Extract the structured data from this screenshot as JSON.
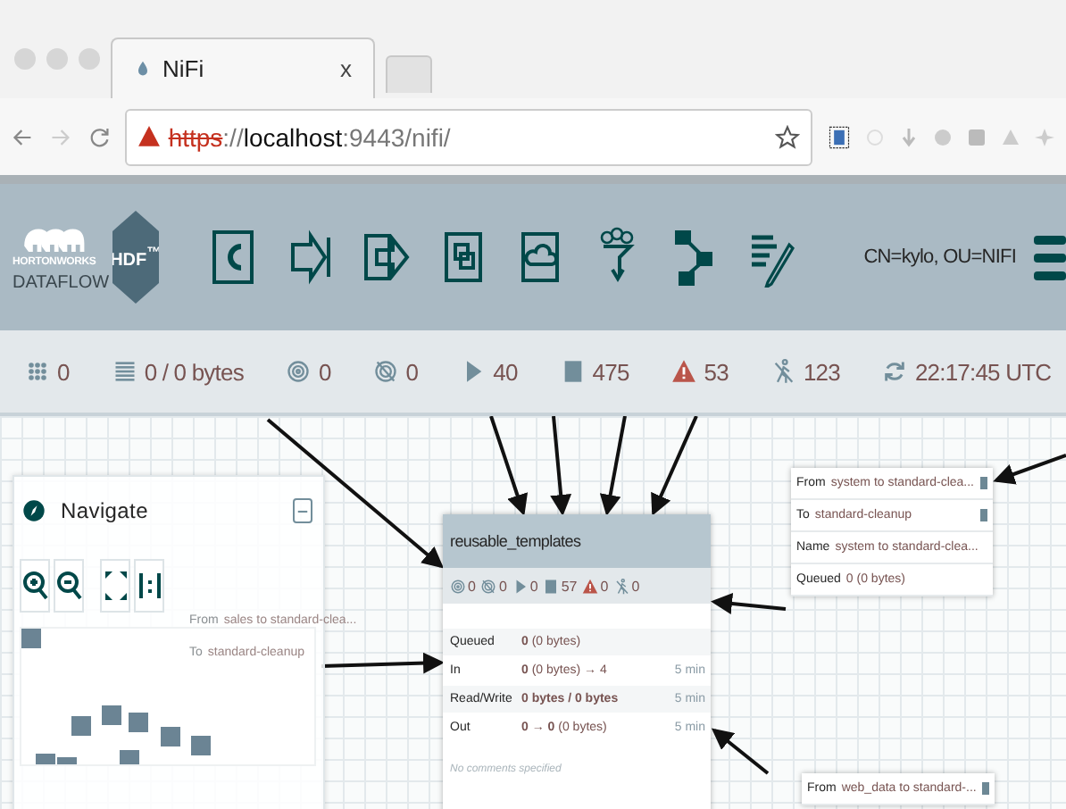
{
  "browser": {
    "tabs": [
      {
        "title": "NiFi",
        "close": "x",
        "selected": true
      }
    ],
    "address": [
      {
        "kind": "scheme",
        "text": "https"
      },
      {
        "kind": "plain",
        "text": "://"
      },
      {
        "kind": "host",
        "text": "localhost"
      },
      {
        "kind": "plain",
        "text": ":9443/nifi/"
      }
    ]
  },
  "header": {
    "logo": {
      "brand": "HORTONWORKS",
      "product": "DATAFLOW",
      "badge": "HDF$^{™}$"
    },
    "toolbar": [
      {
        "kind": "processor"
      },
      {
        "kind": "input-port"
      },
      {
        "kind": "output-port"
      },
      {
        "kind": "process-group"
      },
      {
        "kind": "remote-group"
      },
      {
        "kind": "funnel"
      },
      {
        "kind": "template"
      },
      {
        "kind": "label"
      }
    ],
    "user": "CN=kylo, OU=NIFI"
  },
  "status_bar": {
    "items": [
      {
        "kind": "transmitting",
        "value": "0"
      },
      {
        "kind": "queued",
        "value": "0 / 0 bytes"
      },
      {
        "kind": "remote-on",
        "value": "0"
      },
      {
        "kind": "remote-off",
        "value": "0"
      },
      {
        "kind": "running",
        "value": "40"
      },
      {
        "kind": "stopped",
        "value": "475"
      },
      {
        "kind": "invalid",
        "value": "53"
      },
      {
        "kind": "disabled",
        "value": "123"
      },
      {
        "kind": "refresh",
        "value": "22:17:45 UTC"
      }
    ]
  },
  "navigate": {
    "title": "Navigate",
    "collapsed": false
  },
  "process_group": {
    "name": "reusable_templates",
    "counts": [
      {
        "kind": "remote-on",
        "value": "0"
      },
      {
        "kind": "remote-off",
        "value": "0"
      },
      {
        "kind": "running",
        "value": "0"
      },
      {
        "kind": "stopped",
        "value": "57"
      },
      {
        "kind": "invalid",
        "value": "0"
      },
      {
        "kind": "disabled",
        "value": "0"
      }
    ],
    "rows": [
      {
        "label": "Queued",
        "value": "**0** (0 bytes)"
      },
      {
        "label": "In",
        "value": "**0** (0 bytes) → 4",
        "period": "5 min"
      },
      {
        "label": "Read/Write",
        "value": "**0 bytes / 0 bytes**",
        "period": "5 min"
      },
      {
        "label": "Out",
        "value": "**0 → 0** (0 bytes)",
        "period": "5 min"
      }
    ],
    "comments": "No comments specified"
  },
  "connections": [
    {
      "faded": false,
      "rows": [
        {
          "label": "From",
          "value": "system to standard-clea...",
          "marker": true
        },
        {
          "label": "To",
          "value": "standard-cleanup",
          "marker": true
        },
        {
          "label": "Name",
          "value": "system to standard-clea...",
          "marker": false
        },
        {
          "label": "Queued",
          "value": "0 (0 bytes)",
          "marker": false
        }
      ]
    },
    {
      "faded": true,
      "rows": [
        {
          "label": "From",
          "value": "sales to standard-clea...",
          "marker": false
        },
        {
          "label": "To",
          "value": "standard-cleanup",
          "marker": false
        }
      ]
    },
    {
      "faded": false,
      "rows": [
        {
          "label": "From",
          "value": "web_data to standard-...",
          "marker": true
        }
      ]
    }
  ]
}
